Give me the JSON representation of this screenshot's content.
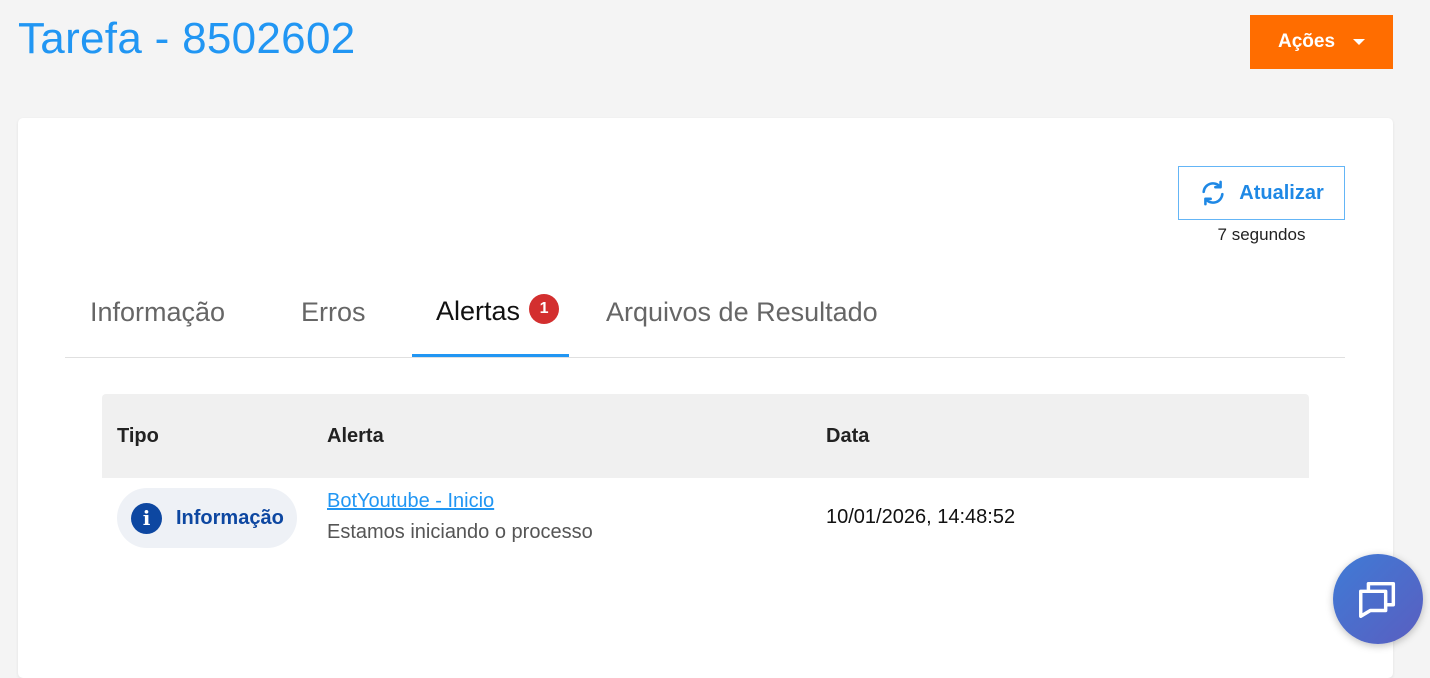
{
  "header": {
    "title": "Tarefa - 8502602",
    "actions_label": "Ações"
  },
  "refresh": {
    "label": "Atualizar",
    "elapsed": "7 segundos"
  },
  "tabs": [
    {
      "label": "Informação",
      "active": false
    },
    {
      "label": "Erros",
      "active": false
    },
    {
      "label": "Alertas",
      "active": true,
      "badge": "1"
    },
    {
      "label": "Arquivos de Resultado",
      "active": false
    }
  ],
  "table": {
    "columns": [
      "Tipo",
      "Alerta",
      "Data"
    ],
    "rows": [
      {
        "type": "Informação",
        "type_icon": "info-icon",
        "alert_title": "BotYoutube - Inicio",
        "alert_description": "Estamos iniciando o processo",
        "date": "10/01/2026, 14:48:52"
      }
    ]
  },
  "colors": {
    "accent": "#2196f3",
    "actions_button": "#ff6d00",
    "badge": "#d32f2f",
    "info": "#0d47a1"
  },
  "icons": {
    "refresh": "refresh-icon",
    "chat": "chat-icon",
    "dropdown": "caret-down-icon"
  }
}
